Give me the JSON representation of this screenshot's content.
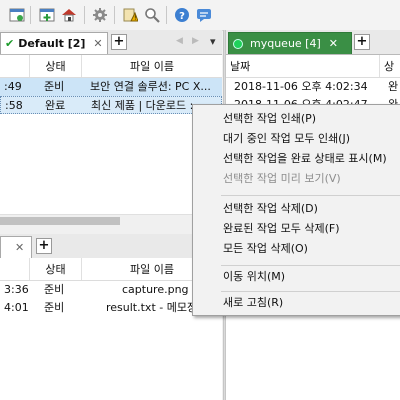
{
  "toolbar": {
    "icons": [
      "layout-icon",
      "add-queue-icon",
      "home-icon",
      "settings-icon",
      "clear-queue-icon",
      "search-icon",
      "help-icon",
      "message-icon"
    ]
  },
  "left_tabs": {
    "active": "Default [2]",
    "close": "✕",
    "add": "+",
    "nav_prev": "◀",
    "nav_next": "▶",
    "menu": "▾"
  },
  "right_tabs": {
    "active": "myqueue [4]",
    "close": "✕",
    "add": "+"
  },
  "queue_default": {
    "columns": [
      "상태",
      "파일 이름"
    ],
    "rows": [
      {
        "time": ":49",
        "status": "준비",
        "file": "보안 연결 솔루션: PC X..."
      },
      {
        "time": ":58",
        "status": "완료",
        "file": "최신 제품 | 다운로드 :"
      }
    ]
  },
  "queue_lower": {
    "columns": [
      "상태",
      "파일 이름"
    ],
    "add": "+",
    "rows": [
      {
        "time": "3:36",
        "status": "준비",
        "file": "capture.png"
      },
      {
        "time": "4:01",
        "status": "준비",
        "file": "result.txt - 메모장"
      }
    ]
  },
  "queue_my": {
    "columns": [
      "날짜",
      "상"
    ],
    "rows": [
      {
        "date": "2018-11-06 오후 4:02:34",
        "status": "완"
      },
      {
        "date": "2018-11-06 오후 4:02:47",
        "status": "완"
      }
    ]
  },
  "context_menu": {
    "items": [
      {
        "label": "선택한 작업 인쇄(P)",
        "enabled": true
      },
      {
        "label": "대기 중인 작업 모두 인쇄(J)",
        "enabled": true
      },
      {
        "label": "선택한 작업을 완료 상태로 표시(M)",
        "enabled": true
      },
      {
        "label": "선택한 작업 미리 보기(V)",
        "enabled": false
      },
      {
        "label": "선택한 작업 삭제(D)",
        "enabled": true
      },
      {
        "label": "완료된 작업 모두 삭제(F)",
        "enabled": true
      },
      {
        "label": "모든 작업 삭제(O)",
        "enabled": true
      },
      {
        "label": "이동 위치(M)",
        "enabled": true
      },
      {
        "label": "새로 고침(R)",
        "enabled": true
      }
    ]
  }
}
